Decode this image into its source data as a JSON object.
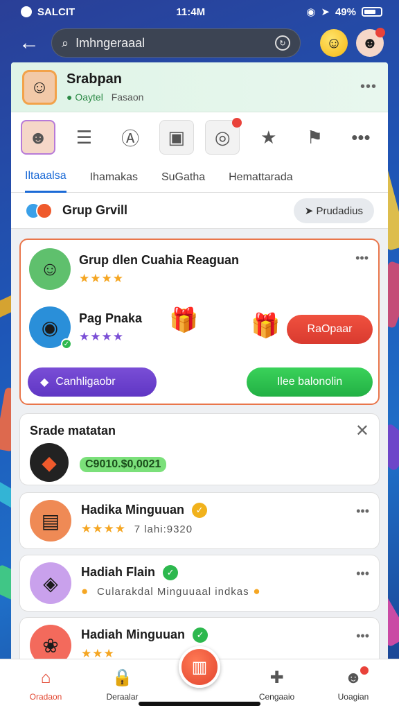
{
  "status_bar": {
    "carrier": "SALCIT",
    "time": "11:4M",
    "battery": "49%"
  },
  "search": {
    "value": "Imhngeraaal"
  },
  "profile": {
    "name": "Srabpan",
    "status": "Oaytel",
    "sub": "Fasaon"
  },
  "tabs": [
    {
      "label": "Iltaaalsa",
      "active": true
    },
    {
      "label": "Ihamakas",
      "active": false
    },
    {
      "label": "SuGatha",
      "active": false
    },
    {
      "label": "Hemattarada",
      "active": false
    }
  ],
  "group": {
    "title": "Grup Grvill",
    "action": "Prudadius"
  },
  "main_card": {
    "item1": {
      "title": "Grup dlen Cuahia Reaguan",
      "stars": "★★★★"
    },
    "item2": {
      "title": "Pag Pnaka",
      "stars": "★★★★",
      "button": "RaOpaar"
    },
    "purple_button": "Canhligaobr",
    "green_button": "Ilee balonolin"
  },
  "section": {
    "title": "Srade matatan",
    "amount": "C9010.$0,0021"
  },
  "items": [
    {
      "title": "Hadika Minguuan",
      "stars": "★★★★",
      "meta": "7 lahi:9320"
    },
    {
      "title": "Hadiah Flain",
      "stars": "",
      "meta": "Cularakdal Minguuaal indkas"
    },
    {
      "title": "Hadiah Minguuan",
      "stars": "★★★",
      "meta": ""
    }
  ],
  "bottom_nav": [
    {
      "label": "Oradaon",
      "icon": "home-icon",
      "active": true
    },
    {
      "label": "Deraalar",
      "icon": "lock-icon",
      "active": false
    },
    {
      "label": "Cengaaio",
      "icon": "puzzle-icon",
      "active": false
    },
    {
      "label": "Uoagian",
      "icon": "user-icon",
      "active": false
    }
  ],
  "colors": {
    "accent": "#1b6ad6",
    "primary_red": "#e2452f",
    "green": "#22b044",
    "purple": "#5f36c4"
  }
}
